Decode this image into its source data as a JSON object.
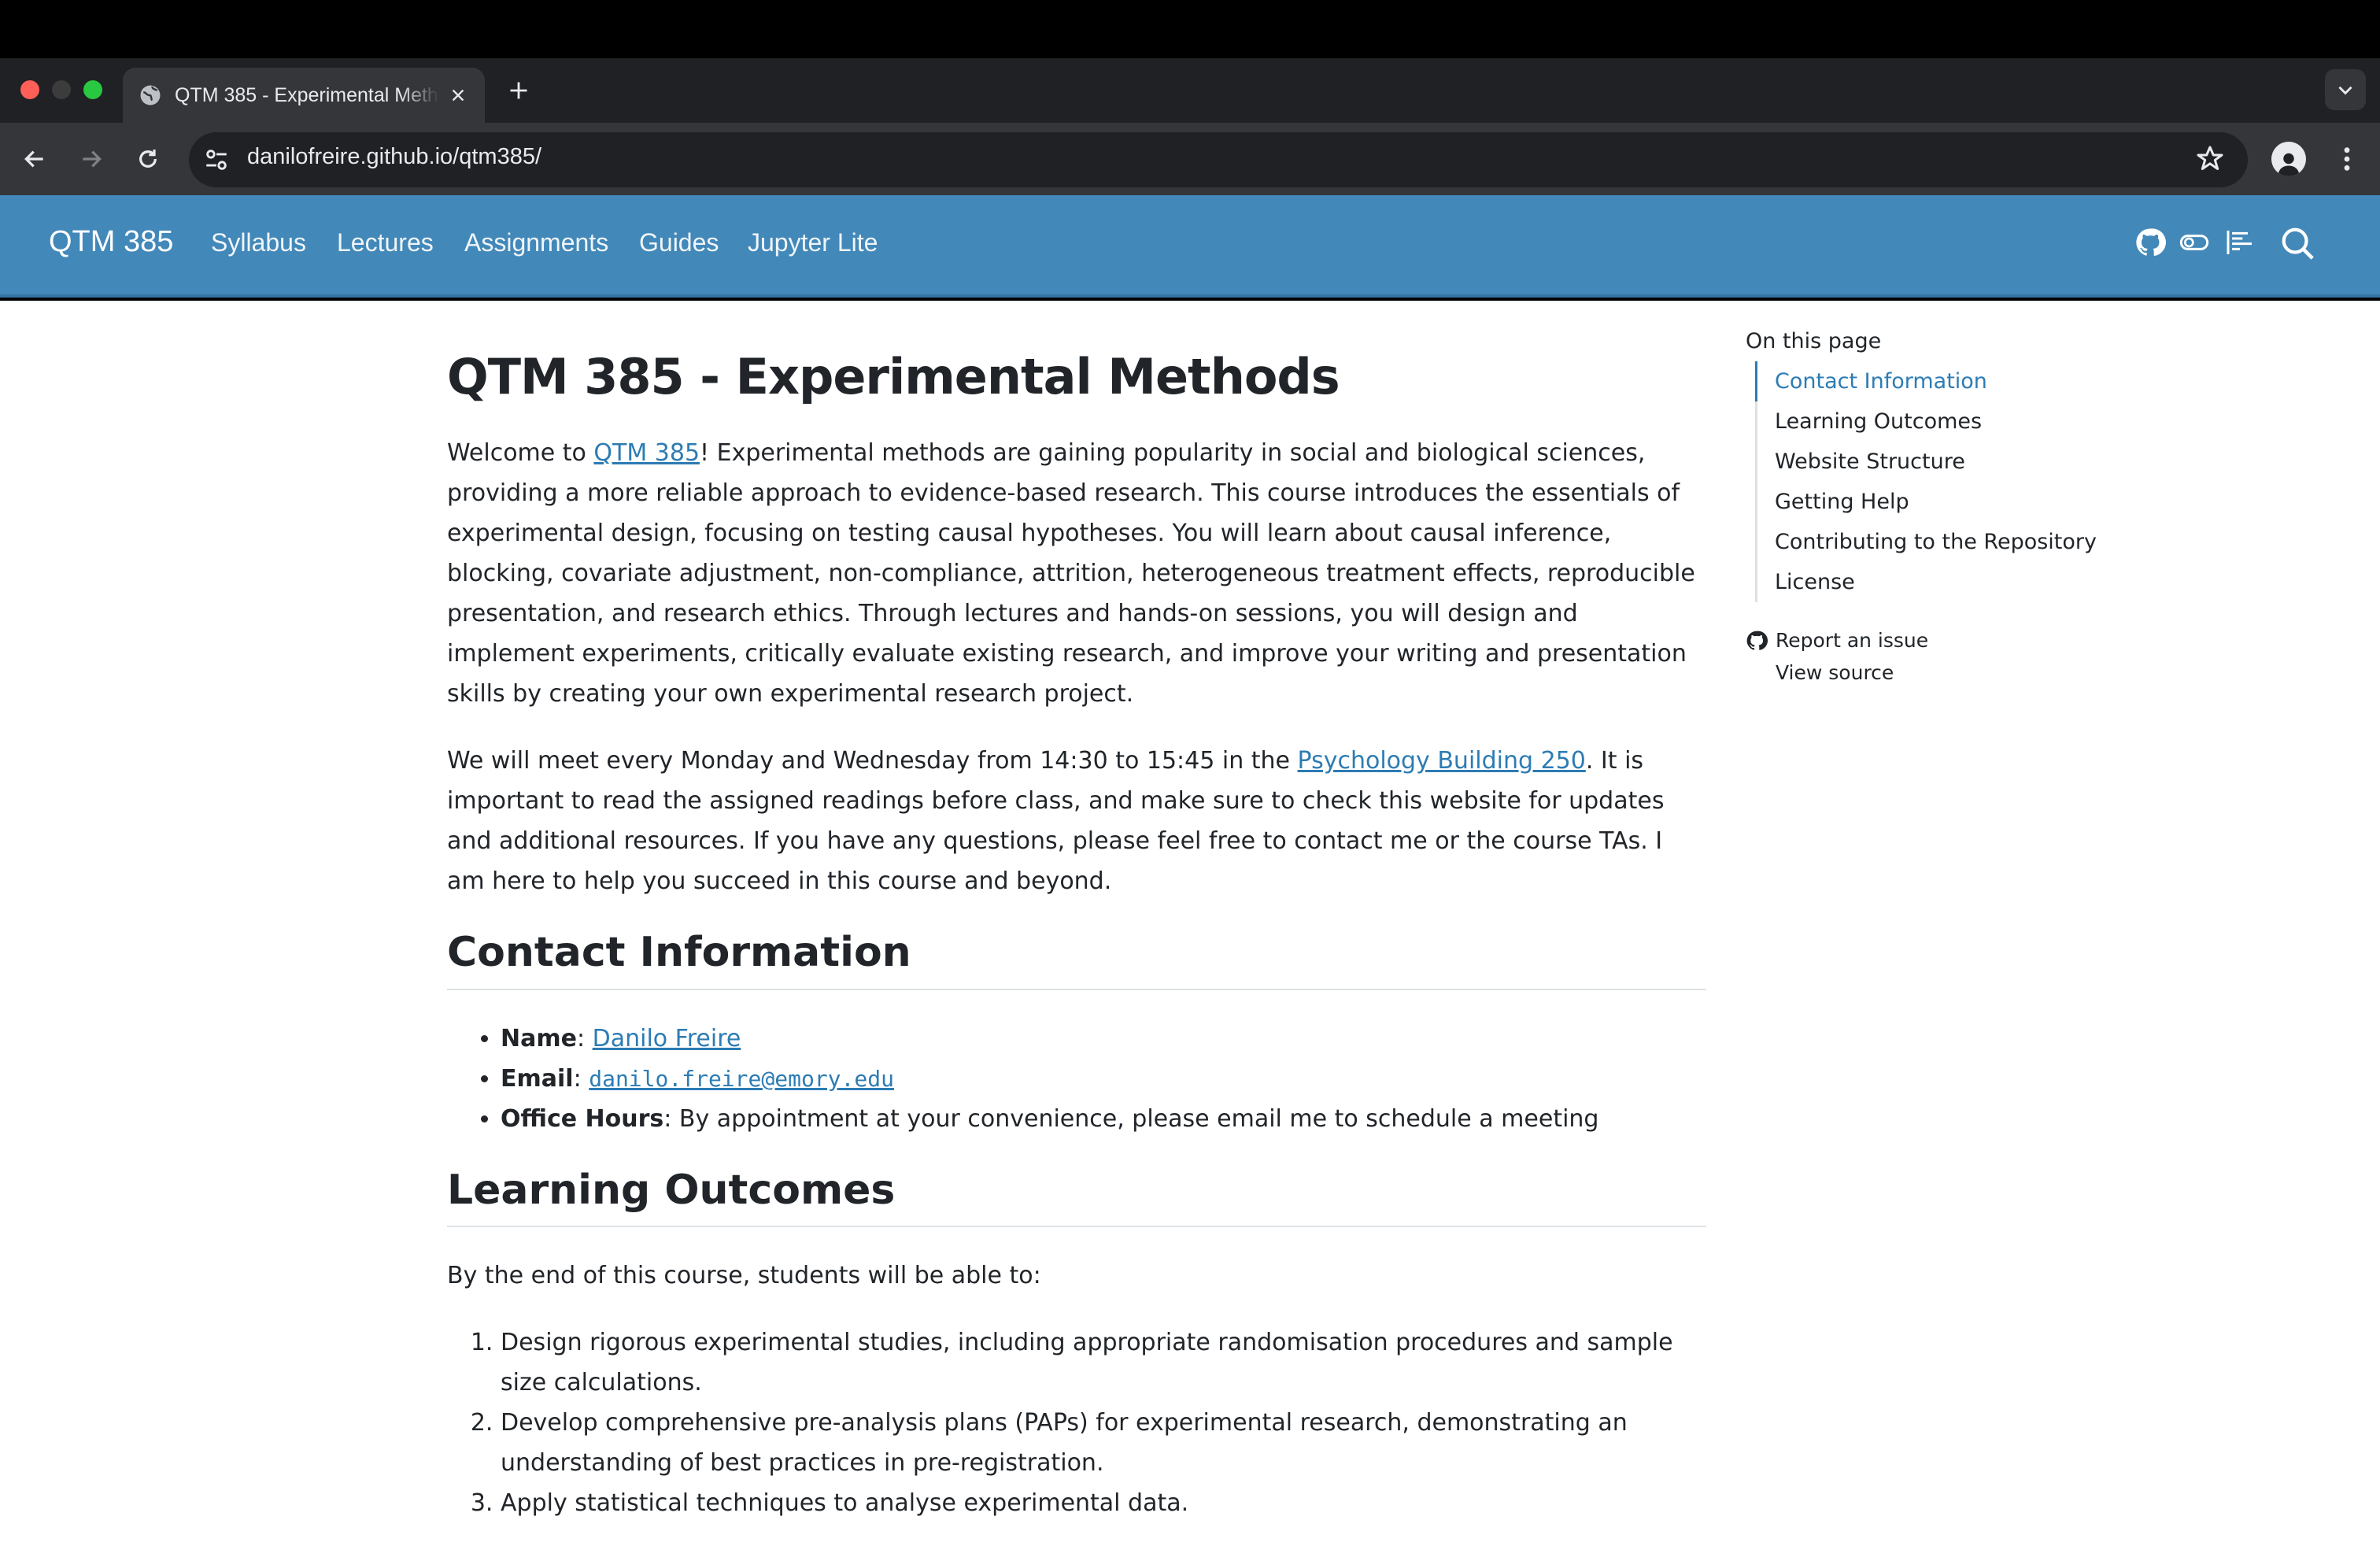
{
  "browser": {
    "tab_title": "QTM 385 - Experimental Methods",
    "url": "danilofreire.github.io/qtm385/"
  },
  "site": {
    "brand": "QTM 385",
    "nav": [
      "Syllabus",
      "Lectures",
      "Assignments",
      "Guides",
      "Jupyter Lite"
    ],
    "accent": "#4288b9",
    "link_color": "#2d7cb3"
  },
  "page": {
    "title": "QTM 385 - Experimental Methods",
    "intro": {
      "before_link": "Welcome to ",
      "link": "QTM 385",
      "after_link": "! Experimental methods are gaining popularity in social and biological sciences, providing a more reliable approach to evidence-based research. This course introduces the essentials of experimental design, focusing on testing causal hypotheses. You will learn about causal inference, blocking, covariate adjustment, non-compliance, attrition, heterogeneous treatment effects, reproducible presentation, and research ethics. Through lectures and hands-on sessions, you will design and implement experiments, critically evaluate existing research, and improve your writing and presentation skills by creating your own experimental research project."
    },
    "meeting": {
      "before_link": "We will meet every Monday and Wednesday from 14:30 to 15:45 in the ",
      "link": "Psychology Building 250",
      "after_link": ". It is important to read the assigned readings before class, and make sure to check this website for updates and additional resources. If you have any questions, please feel free to contact me or the course TAs. I am here to help you succeed in this course and beyond."
    },
    "contact": {
      "heading": "Contact Information",
      "name_label": "Name",
      "name_value": "Danilo Freire",
      "email_label": "Email",
      "email_value": "danilo.freire@emory.edu",
      "hours_label": "Office Hours",
      "hours_value": ": By appointment at your convenience, please email me to schedule a meeting"
    },
    "outcomes": {
      "heading": "Learning Outcomes",
      "lead": "By the end of this course, students will be able to:",
      "items": [
        "Design rigorous experimental studies, including appropriate randomisation procedures and sample size calculations.",
        "Develop comprehensive pre-analysis plans (PAPs) for experimental research, demonstrating an understanding of best practices in pre-registration.",
        "Apply statistical techniques to analyse experimental data."
      ]
    }
  },
  "toc": {
    "title": "On this page",
    "items": [
      "Contact Information",
      "Learning Outcomes",
      "Website Structure",
      "Getting Help",
      "Contributing to the Repository",
      "License"
    ],
    "actions": [
      "Report an issue",
      "View source"
    ]
  }
}
